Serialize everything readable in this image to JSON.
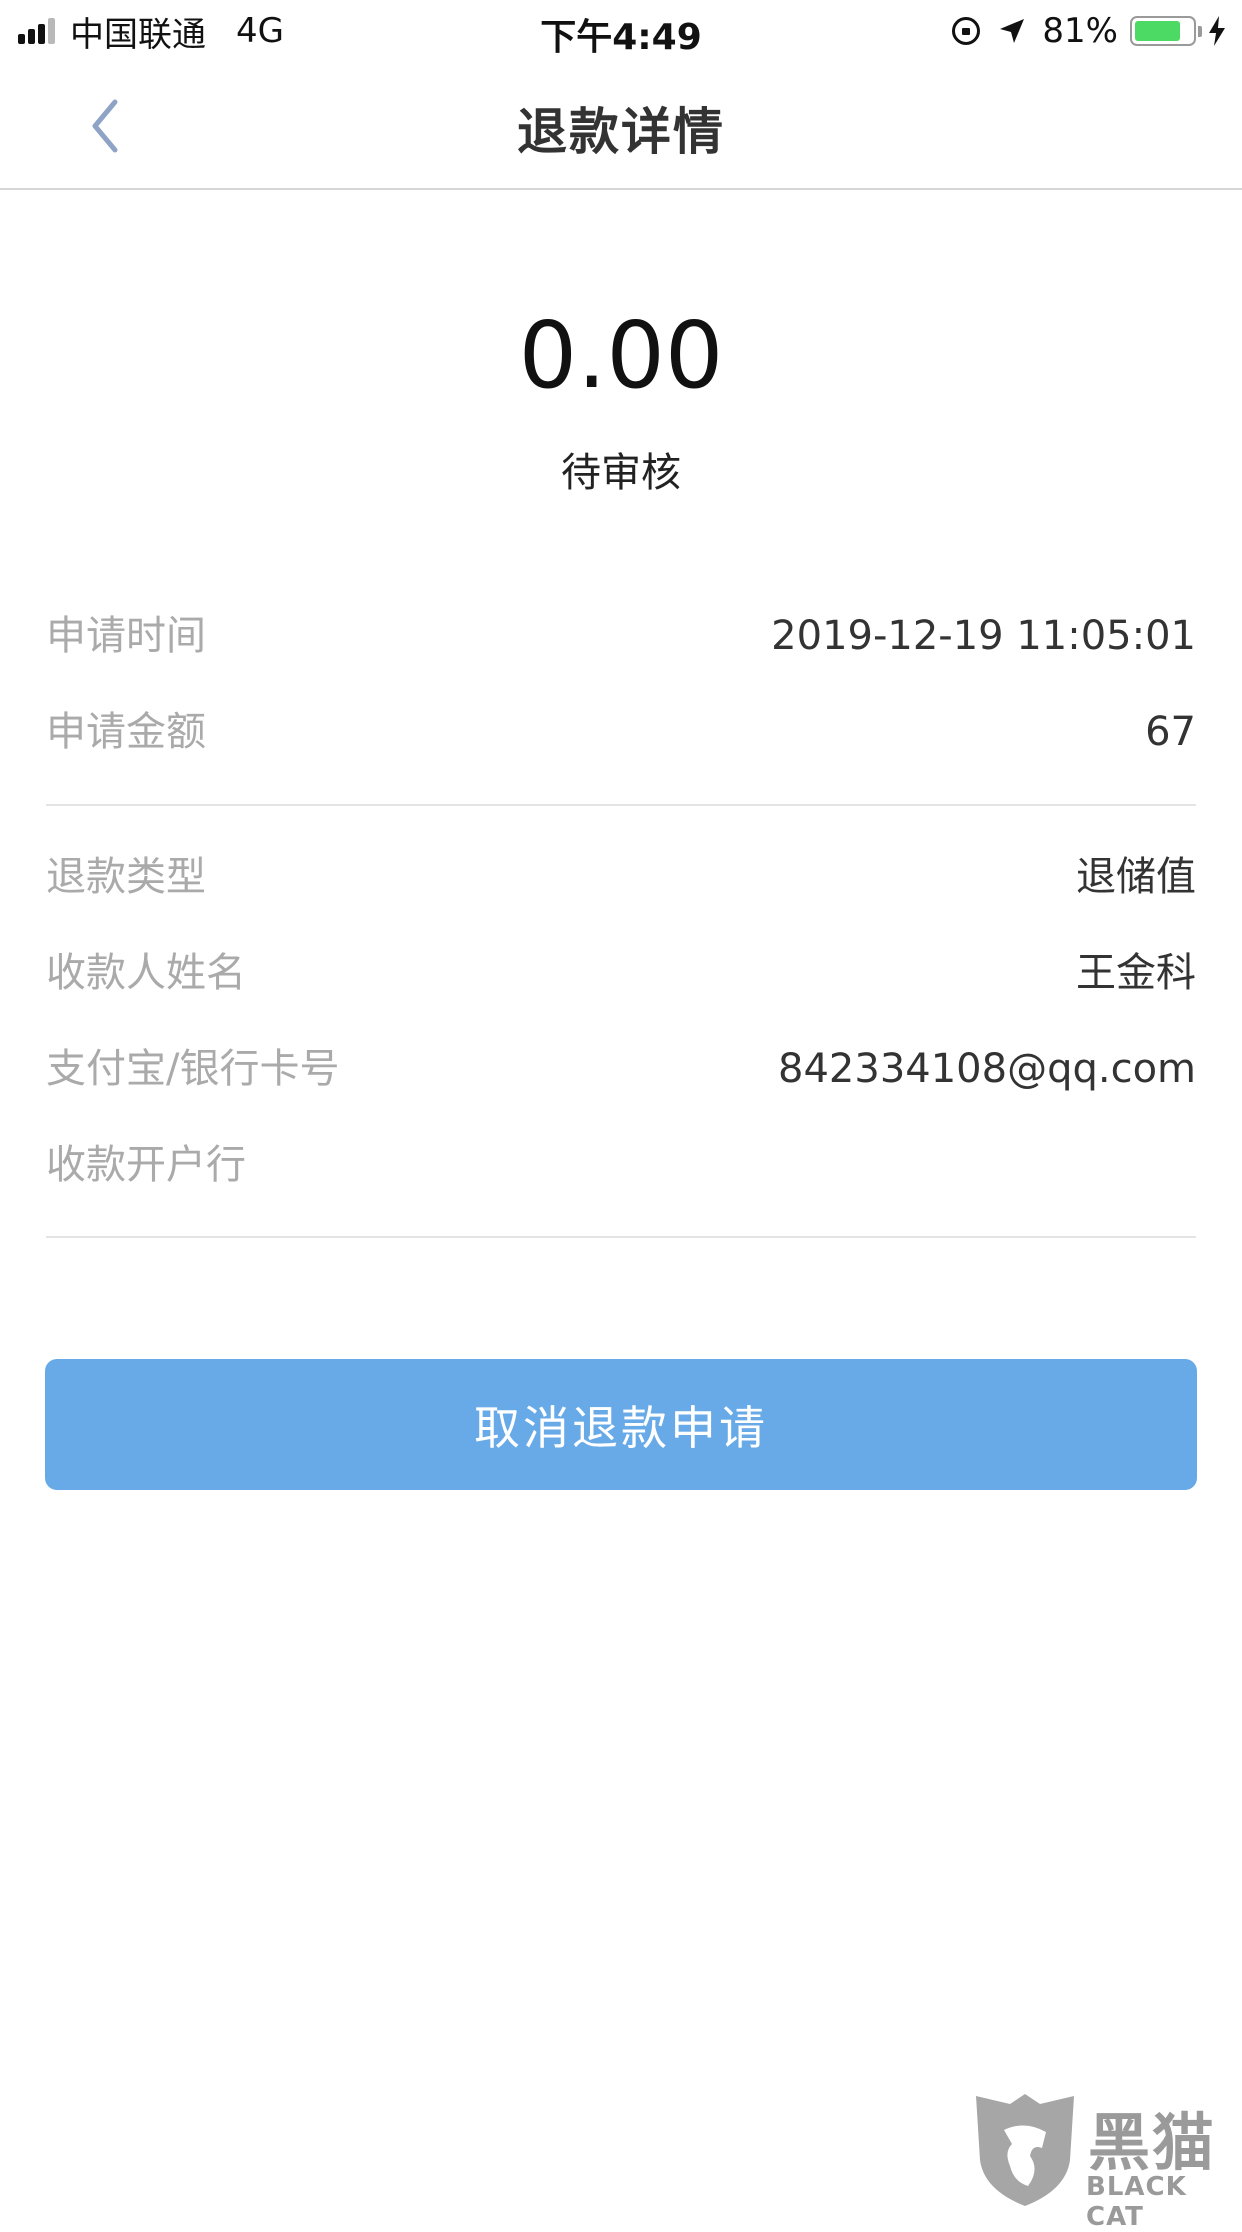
{
  "status_bar": {
    "carrier": "中国联通",
    "network": "4G",
    "time": "下午4:49",
    "battery_percent": "81%",
    "battery_level": 0.81
  },
  "nav": {
    "title": "退款详情"
  },
  "summary": {
    "amount": "0.00",
    "status": "待审核"
  },
  "details": [
    {
      "label": "申请时间",
      "value": "2019-12-19 11:05:01"
    },
    {
      "label": "申请金额",
      "value": "67"
    },
    {
      "label": "退款类型",
      "value": "退储值"
    },
    {
      "label": "收款人姓名",
      "value": "王金科"
    },
    {
      "label": "支付宝/银行卡号",
      "value": "842334108@qq.com"
    },
    {
      "label": "收款开户行",
      "value": ""
    }
  ],
  "actions": {
    "cancel_label": "取消退款申请"
  },
  "watermark": {
    "text": "黑猫",
    "sub": "BLACK CAT"
  },
  "colors": {
    "accent": "#68aae8",
    "label": "#aaaaaa",
    "battery": "#4cd964"
  }
}
